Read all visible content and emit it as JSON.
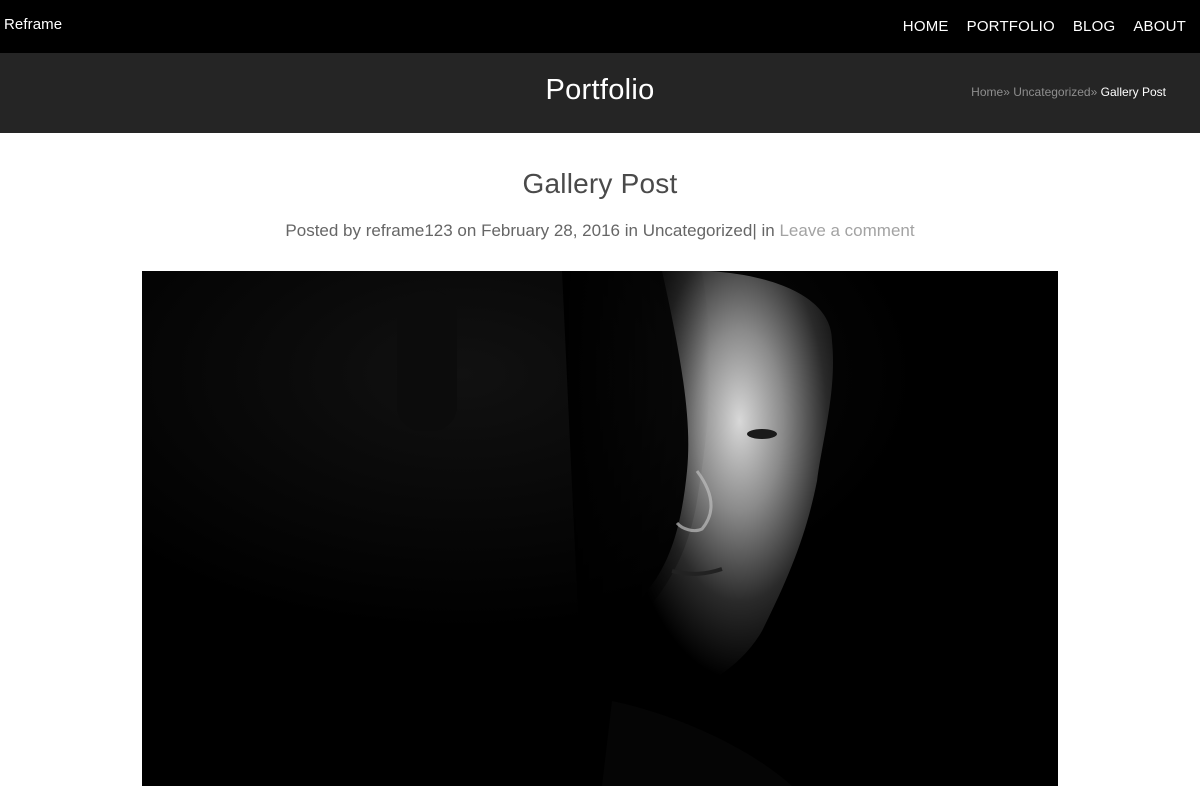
{
  "site": {
    "brand": "Reframe"
  },
  "nav": {
    "items": [
      {
        "label": "HOME"
      },
      {
        "label": "PORTFOLIO"
      },
      {
        "label": "BLOG"
      },
      {
        "label": "ABOUT"
      }
    ]
  },
  "header": {
    "title": "Portfolio",
    "breadcrumb": {
      "home": "Home",
      "separator": "»",
      "category": "Uncategorized",
      "current": "Gallery Post"
    }
  },
  "post": {
    "title": "Gallery Post",
    "meta": {
      "posted_by_prefix": "Posted by",
      "author": "reframe123",
      "on_word": "on",
      "date": "February 28, 2016",
      "in_word": "in",
      "category": "Uncategorized",
      "divider": "|",
      "in_word_2": "in",
      "comments_link": "Leave a comment"
    },
    "featured_image": {
      "description": "black-and-white portrait photo"
    }
  },
  "colors": {
    "topbar": "#000000",
    "titleband": "#252525",
    "text_dark": "#4a4a4a",
    "meta_text": "#666666",
    "link_light": "#a3a3a3"
  }
}
